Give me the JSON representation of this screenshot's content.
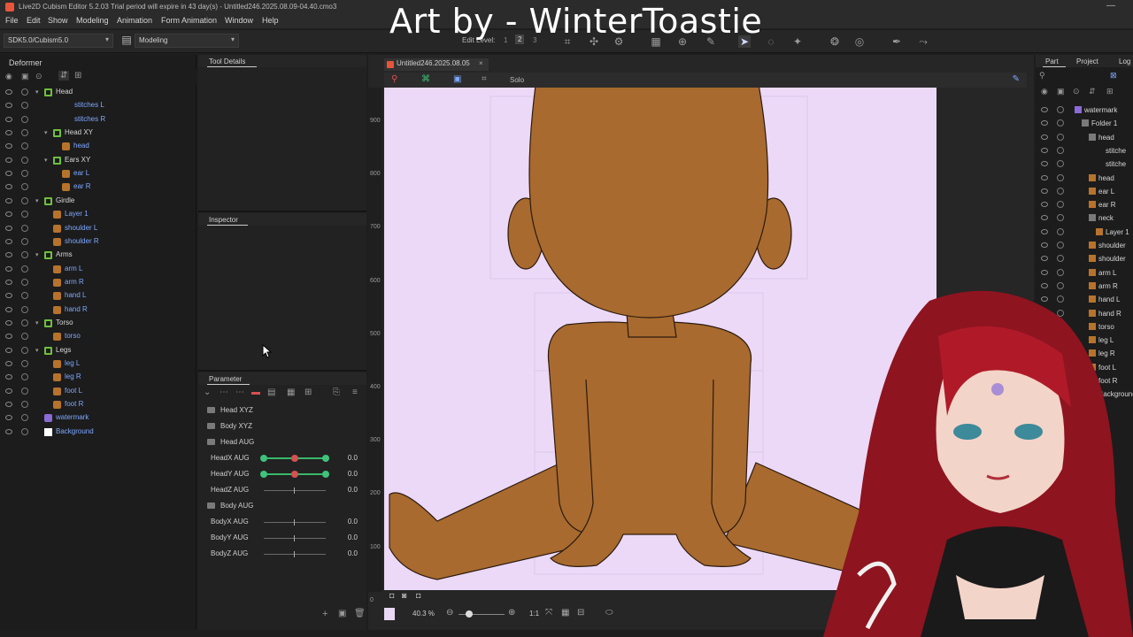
{
  "titlebar": {
    "title": "Live2D Cubism Editor 5.2.03   Trial period will expire in 43 day(s) - Untitled246.2025.08.09-04.40.cmo3",
    "minimize": "—"
  },
  "menu": [
    "File",
    "Edit",
    "Show",
    "Modeling",
    "Animation",
    "Form Animation",
    "Window",
    "Help"
  ],
  "overlay_title": "Art by - WinterToastie",
  "toolbar": {
    "sdk_select": "SDK5.0/Cubism5.0",
    "mode_select": "Modeling",
    "edit_level_label": "Edit Level:",
    "edit_levels": [
      "1",
      "2",
      "3"
    ]
  },
  "panels": {
    "deformer": "Deformer",
    "tool_details": "Tool Details",
    "inspector": "Inspector",
    "parameter": "Parameter",
    "part": "Part",
    "project": "Project",
    "log": "Log"
  },
  "deformer_tree": [
    {
      "label": "Head",
      "kind": "deformer",
      "indent": 0,
      "color": "white",
      "open": true
    },
    {
      "label": "stitches L",
      "kind": "none",
      "indent": 2,
      "color": "blue"
    },
    {
      "label": "stitches R",
      "kind": "none",
      "indent": 2,
      "color": "blue"
    },
    {
      "label": "Head XY",
      "kind": "deformer",
      "indent": 1,
      "color": "white",
      "open": true
    },
    {
      "label": "head",
      "kind": "art",
      "indent": 2,
      "color": "blue"
    },
    {
      "label": "Ears XY",
      "kind": "deformer",
      "indent": 1,
      "color": "white",
      "open": true
    },
    {
      "label": "ear L",
      "kind": "art",
      "indent": 2,
      "color": "blue"
    },
    {
      "label": "ear R",
      "kind": "art",
      "indent": 2,
      "color": "blue"
    },
    {
      "label": "Girdle",
      "kind": "deformer",
      "indent": 0,
      "color": "white",
      "open": true
    },
    {
      "label": "Layer 1",
      "kind": "art",
      "indent": 1,
      "color": "blue"
    },
    {
      "label": "shoulder L",
      "kind": "art",
      "indent": 1,
      "color": "blue"
    },
    {
      "label": "shoulder R",
      "kind": "art",
      "indent": 1,
      "color": "blue"
    },
    {
      "label": "Arms",
      "kind": "deformer",
      "indent": 0,
      "color": "white",
      "open": true
    },
    {
      "label": "arm L",
      "kind": "art",
      "indent": 1,
      "color": "blue"
    },
    {
      "label": "arm R",
      "kind": "art",
      "indent": 1,
      "color": "blue"
    },
    {
      "label": "hand L",
      "kind": "art",
      "indent": 1,
      "color": "blue"
    },
    {
      "label": "hand R",
      "kind": "art",
      "indent": 1,
      "color": "blue"
    },
    {
      "label": "Torso",
      "kind": "deformer",
      "indent": 0,
      "color": "white",
      "open": true
    },
    {
      "label": "torso",
      "kind": "art",
      "indent": 1,
      "color": "blue"
    },
    {
      "label": "Legs",
      "kind": "deformer",
      "indent": 0,
      "color": "white",
      "open": true
    },
    {
      "label": "leg L",
      "kind": "art",
      "indent": 1,
      "color": "blue"
    },
    {
      "label": "leg R",
      "kind": "art",
      "indent": 1,
      "color": "blue"
    },
    {
      "label": "foot L",
      "kind": "art",
      "indent": 1,
      "color": "blue"
    },
    {
      "label": "foot R",
      "kind": "art",
      "indent": 1,
      "color": "blue"
    },
    {
      "label": "watermark",
      "kind": "wm",
      "indent": 0,
      "color": "blue"
    },
    {
      "label": "Background",
      "kind": "bg",
      "indent": 0,
      "color": "blue"
    }
  ],
  "parameters": [
    {
      "type": "group",
      "label": "Head XYZ"
    },
    {
      "type": "group",
      "label": "Body XYZ"
    },
    {
      "type": "group",
      "label": "Head AUG"
    },
    {
      "type": "param",
      "label": "HeadX AUG",
      "value": "0.0",
      "active": true
    },
    {
      "type": "param",
      "label": "HeadY AUG",
      "value": "0.0",
      "active": true
    },
    {
      "type": "param",
      "label": "HeadZ AUG",
      "value": "0.0",
      "active": false
    },
    {
      "type": "group",
      "label": "Body AUG"
    },
    {
      "type": "param",
      "label": "BodyX AUG",
      "value": "0.0",
      "active": false
    },
    {
      "type": "param",
      "label": "BodyY AUG",
      "value": "0.0",
      "active": false
    },
    {
      "type": "param",
      "label": "BodyZ AUG",
      "value": "0.0",
      "active": false
    }
  ],
  "document_tab": "Untitled246.2025.08.05",
  "canvas_toolbar": {
    "solo": "Solo"
  },
  "ruler_ticks": [
    "900",
    "800",
    "700",
    "600",
    "500",
    "400",
    "300",
    "200",
    "100",
    "0"
  ],
  "zoom": "40.3 %",
  "zoom_ratio": "1:1",
  "part_tree": [
    {
      "label": "watermark",
      "ic": "wm"
    },
    {
      "label": "Folder 1",
      "ic": "folder"
    },
    {
      "label": "head",
      "ic": "folder"
    },
    {
      "label": "stitche",
      "ic": "none"
    },
    {
      "label": "stitche",
      "ic": "none"
    },
    {
      "label": "head",
      "ic": "art"
    },
    {
      "label": "ear L",
      "ic": "art"
    },
    {
      "label": "ear R",
      "ic": "art"
    },
    {
      "label": "neck",
      "ic": "folder"
    },
    {
      "label": "Layer 1",
      "ic": "art"
    },
    {
      "label": "shoulder",
      "ic": "art"
    },
    {
      "label": "shoulder",
      "ic": "art"
    },
    {
      "label": "arm L",
      "ic": "art"
    },
    {
      "label": "arm R",
      "ic": "art"
    },
    {
      "label": "hand L",
      "ic": "art"
    },
    {
      "label": "hand R",
      "ic": "art"
    },
    {
      "label": "torso",
      "ic": "art"
    },
    {
      "label": "leg L",
      "ic": "art"
    },
    {
      "label": "leg R",
      "ic": "art"
    },
    {
      "label": "foot L",
      "ic": "art"
    },
    {
      "label": "foot R",
      "ic": "art"
    },
    {
      "label": "Background",
      "ic": "none"
    }
  ],
  "colors": {
    "canvas_bg": "#ecd9f7",
    "skin": "#a86a2e",
    "accent_green": "#39b86a",
    "label_blue": "#7ea8ff"
  }
}
